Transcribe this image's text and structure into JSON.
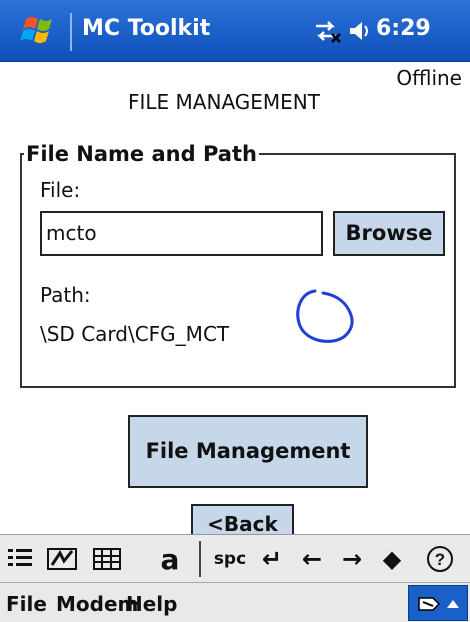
{
  "titlebar": {
    "app_name": "MC Toolkit",
    "time": "6:29"
  },
  "status": "Offline",
  "heading": "FILE MANAGEMENT",
  "group": {
    "legend": "File Name and Path",
    "file_label": "File:",
    "file_value": "mcto",
    "browse_label": "Browse",
    "path_label": "Path:",
    "path_value": "\\SD Card\\CFG_MCT"
  },
  "buttons": {
    "file_management": "File Management",
    "back": "<Back"
  },
  "sip_toolbar": [
    "list-icon",
    "handwriting-icon",
    "grid-icon",
    "a",
    "spc",
    "↵",
    "←",
    "→",
    "◆",
    "?"
  ],
  "menubar": {
    "items": [
      "File",
      "Modem",
      "Help"
    ]
  },
  "colors": {
    "titlebar": "#1b5fc8",
    "button_face": "#c6d7ea",
    "ink": "#1f3fd6"
  }
}
